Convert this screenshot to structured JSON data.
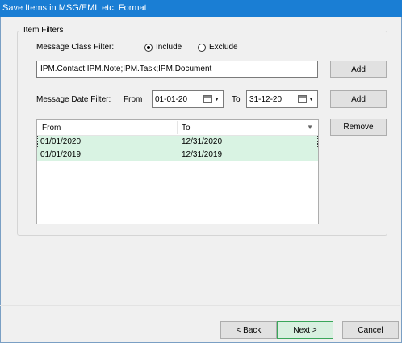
{
  "window": {
    "title": "Save Items in MSG/EML etc. Format"
  },
  "item_filters": {
    "group_label": "Item Filters",
    "message_class": {
      "label": "Message Class Filter:",
      "radio_include": "Include",
      "radio_exclude": "Exclude",
      "selected": "Include",
      "value": "IPM.Contact;IPM.Note;IPM.Task;IPM.Document",
      "add_label": "Add"
    },
    "message_date": {
      "label": "Message Date Filter:",
      "from_label": "From",
      "from_value": "01-01-20",
      "to_label": "To",
      "to_value": "31-12-20",
      "add_label": "Add"
    },
    "date_list": {
      "columns": [
        "From",
        "To"
      ],
      "rows": [
        {
          "from": "01/01/2020",
          "to": "12/31/2020",
          "selected": true
        },
        {
          "from": "01/01/2019",
          "to": "12/31/2019",
          "selected": false
        }
      ]
    },
    "remove_label": "Remove"
  },
  "footer": {
    "back_label": "< Back",
    "next_label": "Next >",
    "cancel_label": "Cancel"
  }
}
